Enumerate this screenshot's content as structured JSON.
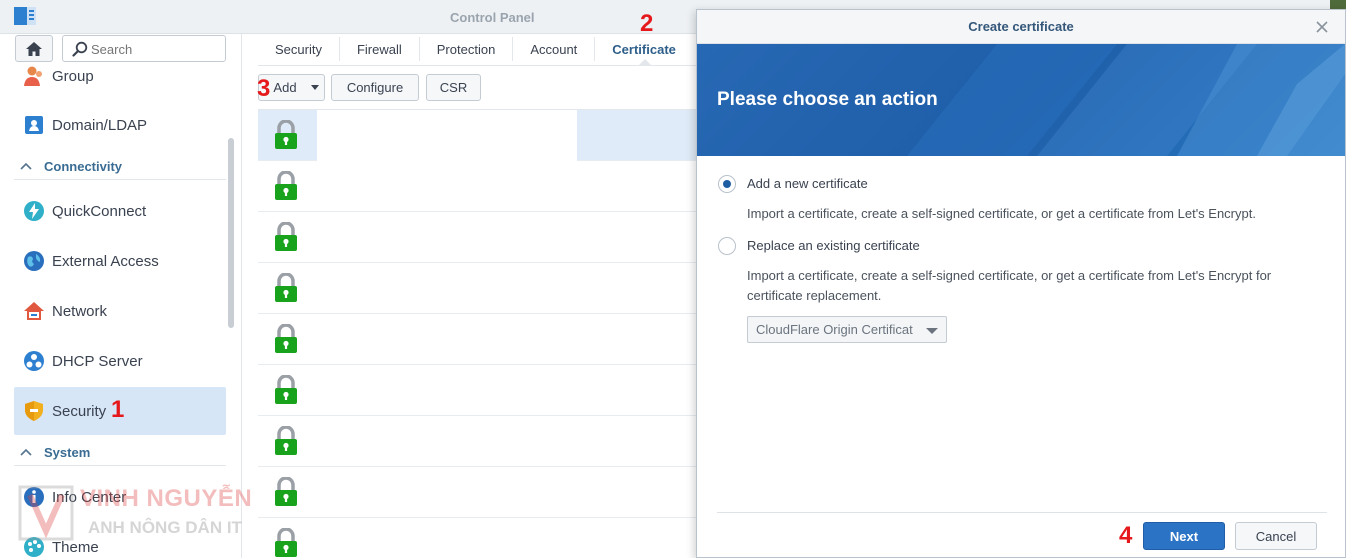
{
  "window": {
    "title": "Control Panel"
  },
  "sidebar": {
    "search_placeholder": "Search",
    "items": [
      {
        "label": "Group",
        "icon": "group-icon"
      },
      {
        "label": "Domain/LDAP",
        "icon": "domain-ldap-icon"
      },
      {
        "label": "QuickConnect",
        "icon": "quickconnect-icon"
      },
      {
        "label": "External Access",
        "icon": "external-access-icon"
      },
      {
        "label": "Network",
        "icon": "network-icon"
      },
      {
        "label": "DHCP Server",
        "icon": "dhcp-server-icon"
      },
      {
        "label": "Security",
        "icon": "security-shield-icon",
        "active": true
      },
      {
        "label": "Info Center",
        "icon": "info-center-icon"
      },
      {
        "label": "Theme",
        "icon": "theme-icon"
      }
    ],
    "sections": [
      {
        "label": "Connectivity"
      },
      {
        "label": "System"
      }
    ]
  },
  "tabs": [
    {
      "label": "Security"
    },
    {
      "label": "Firewall"
    },
    {
      "label": "Protection"
    },
    {
      "label": "Account"
    },
    {
      "label": "Certificate",
      "active": true
    }
  ],
  "toolbar": {
    "add_label": "Add",
    "configure_label": "Configure",
    "csr_label": "CSR"
  },
  "cert_list": {
    "row_count": 9,
    "selected_index": 0
  },
  "annotations": {
    "step1": "1",
    "step2": "2",
    "step3": "3",
    "step4": "4"
  },
  "dialog": {
    "title": "Create certificate",
    "heading": "Please choose an action",
    "option1_label": "Add a new certificate",
    "option1_desc": "Import a certificate, create a self-signed certificate, or get a certificate from Let's Encrypt.",
    "option2_label": "Replace an existing certificate",
    "option2_desc_line1": "Import a certificate, create a self-signed certificate, or get a certificate from Let's Encrypt for",
    "option2_desc_line2": "certificate replacement.",
    "select_value": "CloudFlare Origin Certificat",
    "selected_option": 1,
    "next_label": "Next",
    "cancel_label": "Cancel"
  },
  "watermark": {
    "name": "VINH NGUYỄN",
    "sub": "ANH NÔNG DÂN IT"
  },
  "colors": {
    "accent": "#2b73c4",
    "active_item": "#d6e6f7",
    "lock_green": "#19a31c",
    "annotation_red": "#e5191c"
  }
}
